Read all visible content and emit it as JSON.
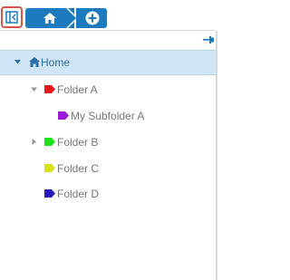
{
  "breadcrumb": {
    "home_label": "Home",
    "add_label": "Add"
  },
  "tree": {
    "root": {
      "label": "Home",
      "icon": "house-icon",
      "expanded": true
    },
    "items": [
      {
        "label": "Folder A",
        "color": "#e21b1b",
        "expanded": true,
        "has_children": true,
        "level": 1
      },
      {
        "label": "My Subfolder A",
        "color": "#9b1bd6",
        "expanded": false,
        "has_children": false,
        "level": 2
      },
      {
        "label": "Folder B",
        "color": "#22e01a",
        "expanded": false,
        "has_children": true,
        "level": 1
      },
      {
        "label": "Folder C",
        "color": "#d8e01a",
        "expanded": false,
        "has_children": false,
        "level": 1
      },
      {
        "label": "Folder D",
        "color": "#2a1bb8",
        "expanded": false,
        "has_children": false,
        "level": 1
      }
    ]
  }
}
